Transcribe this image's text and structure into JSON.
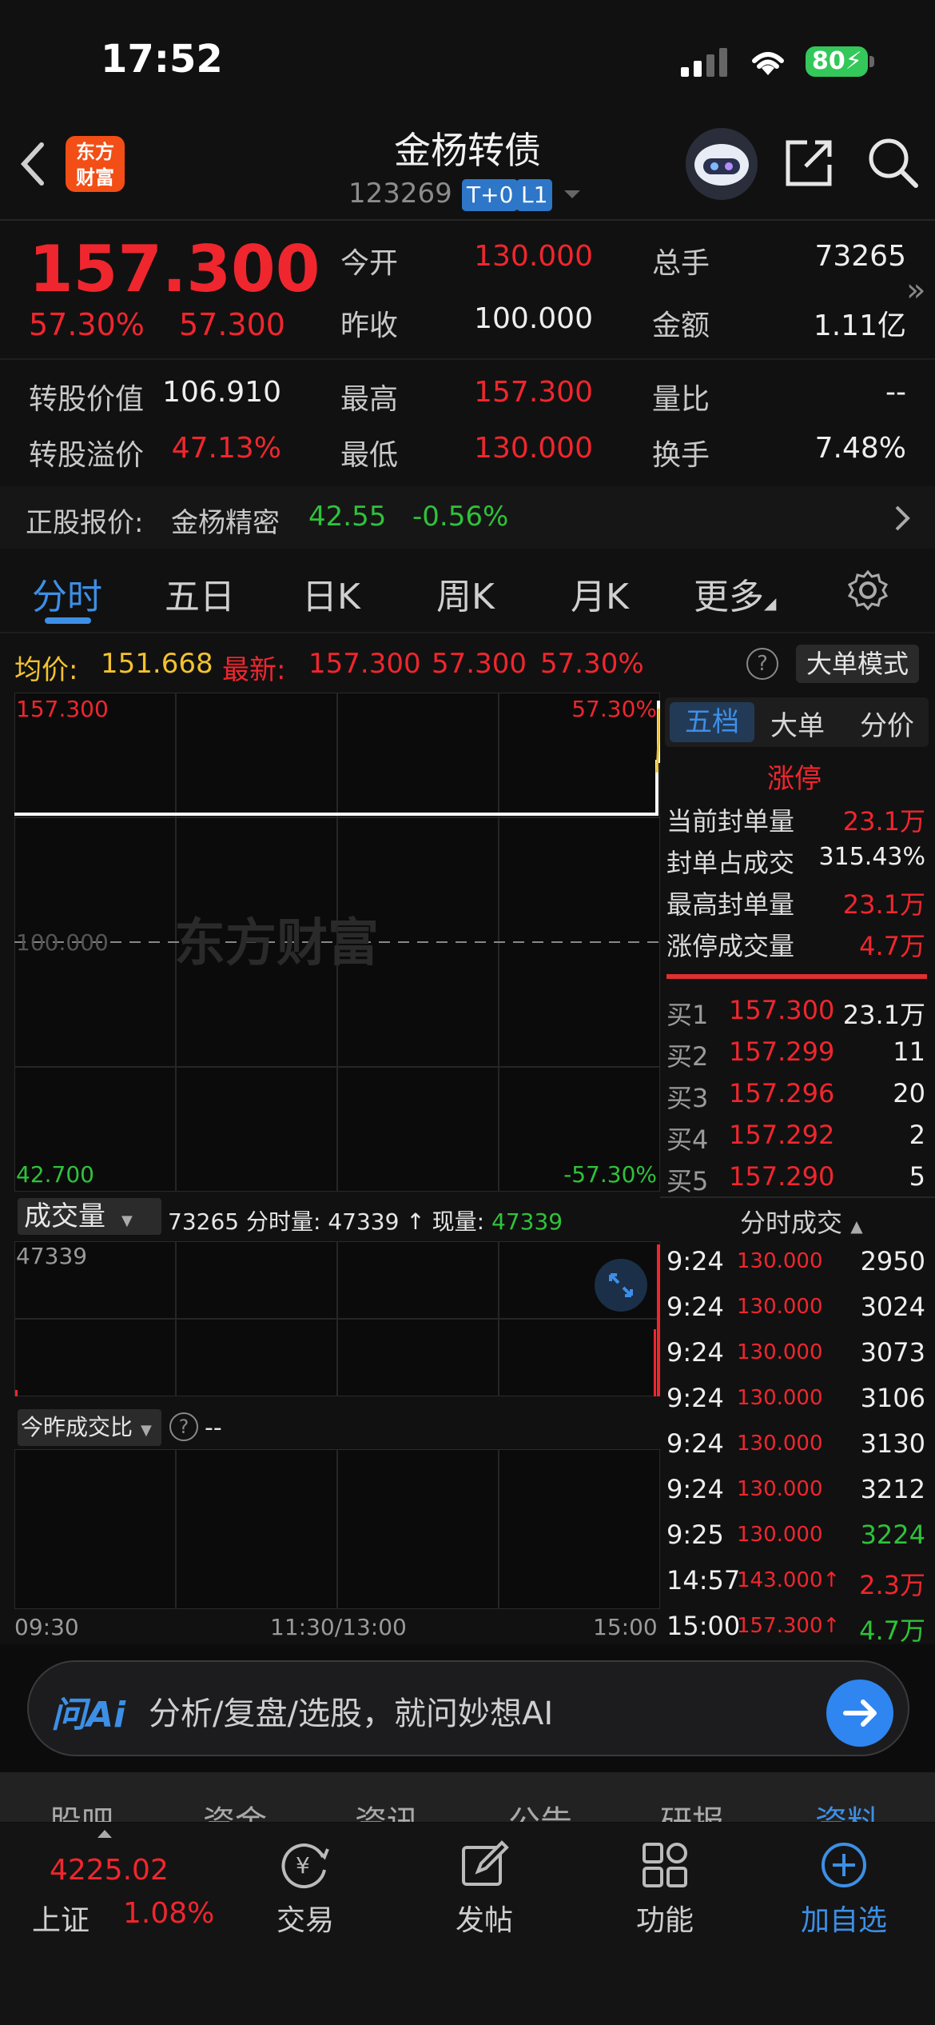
{
  "status_bar": {
    "time": "17:52",
    "battery": "80"
  },
  "header": {
    "logo_text_1": "东方",
    "logo_text_2": "财富",
    "title": "金杨转债",
    "code": "123269",
    "tag_t0": "T+0",
    "tag_l1": "L1"
  },
  "quote": {
    "price": "157.300",
    "change_pct": "57.30%",
    "change_amt": "57.300",
    "open_label": "今开",
    "open": "130.000",
    "prev_close_label": "昨收",
    "prev_close": "100.000",
    "total_volume_label": "总手",
    "total_volume": "73265",
    "amount_label": "金额",
    "amount": "1.11亿",
    "conv_value_label": "转股价值",
    "conv_value": "106.910",
    "high_label": "最高",
    "high": "157.300",
    "volume_ratio_label": "量比",
    "volume_ratio": "--",
    "conv_premium_label": "转股溢价",
    "conv_premium": "47.13%",
    "low_label": "最低",
    "low": "130.000",
    "turnover_label": "换手",
    "turnover": "7.48%"
  },
  "underlying": {
    "label": "正股报价:",
    "name": "金杨精密",
    "price": "42.55",
    "change": "-0.56%"
  },
  "tabs": [
    "分时",
    "五日",
    "日K",
    "周K",
    "月K",
    "更多"
  ],
  "info_row": {
    "avg_label": "均价:",
    "avg": "151.668",
    "latest_label": "最新:",
    "latest": "157.300",
    "latest_chg": "57.300",
    "latest_pct": "57.30%",
    "help": "?",
    "bigorder_btn": "大单模式"
  },
  "price_chart": {
    "top_left": "157.300",
    "top_right": "57.30%",
    "mid_left": "100.000",
    "bottom_left": "42.700",
    "bottom_right": "-57.30%",
    "watermark": "东方财富"
  },
  "volume": {
    "selector": "成交量",
    "summary_total": "73265",
    "summary_text": "分时量: 47339 ↑ 现量:",
    "summary_now": "47339",
    "max": "47339"
  },
  "ratio": {
    "selector": "今昨成交比",
    "value": "--"
  },
  "time_axis": {
    "start": "09:30",
    "mid": "11:30/13:00",
    "end": "15:00"
  },
  "order_panel": {
    "tabs": [
      "五档",
      "大单",
      "分价"
    ],
    "limit_title": "涨停",
    "stats": [
      {
        "label": "当前封单量",
        "value": "23.1万"
      },
      {
        "label": "封单占成交",
        "value": "315.43%"
      },
      {
        "label": "最高封单量",
        "value": "23.1万"
      },
      {
        "label": "涨停成交量",
        "value": "4.7万"
      }
    ],
    "bids": [
      {
        "label": "买1",
        "price": "157.300",
        "vol": "23.1万"
      },
      {
        "label": "买2",
        "price": "157.299",
        "vol": "11"
      },
      {
        "label": "买3",
        "price": "157.296",
        "vol": "20"
      },
      {
        "label": "买4",
        "price": "157.292",
        "vol": "2"
      },
      {
        "label": "买5",
        "price": "157.290",
        "vol": "5"
      }
    ],
    "trades_title": "分时成交",
    "trades": [
      {
        "time": "9:24",
        "price": "130.000",
        "vol": "2950"
      },
      {
        "time": "9:24",
        "price": "130.000",
        "vol": "3024"
      },
      {
        "time": "9:24",
        "price": "130.000",
        "vol": "3073"
      },
      {
        "time": "9:24",
        "price": "130.000",
        "vol": "3106"
      },
      {
        "time": "9:24",
        "price": "130.000",
        "vol": "3130"
      },
      {
        "time": "9:24",
        "price": "130.000",
        "vol": "3212"
      },
      {
        "time": "9:25",
        "price": "130.000",
        "vol": "3224"
      },
      {
        "time": "14:57",
        "price": "143.000↑",
        "vol": "2.3万"
      },
      {
        "time": "15:00",
        "price": "157.300↑",
        "vol": "4.7万"
      }
    ]
  },
  "ai_bar": {
    "logo": "问Ai",
    "placeholder": "分析/复盘/选股，就问妙想AI"
  },
  "bottom_tabs": [
    "股吧",
    "资金",
    "资讯",
    "公告",
    "研报",
    "资料"
  ],
  "bottom_nav": {
    "index_value": "4225.02",
    "index_name": "上证",
    "index_pct": "1.08%",
    "trade": "交易",
    "post": "发帖",
    "functions": "功能",
    "add_watch": "加自选"
  },
  "colors": {
    "up": "#f0262e",
    "down": "#2fc23a",
    "accent": "#3d8fe6"
  }
}
